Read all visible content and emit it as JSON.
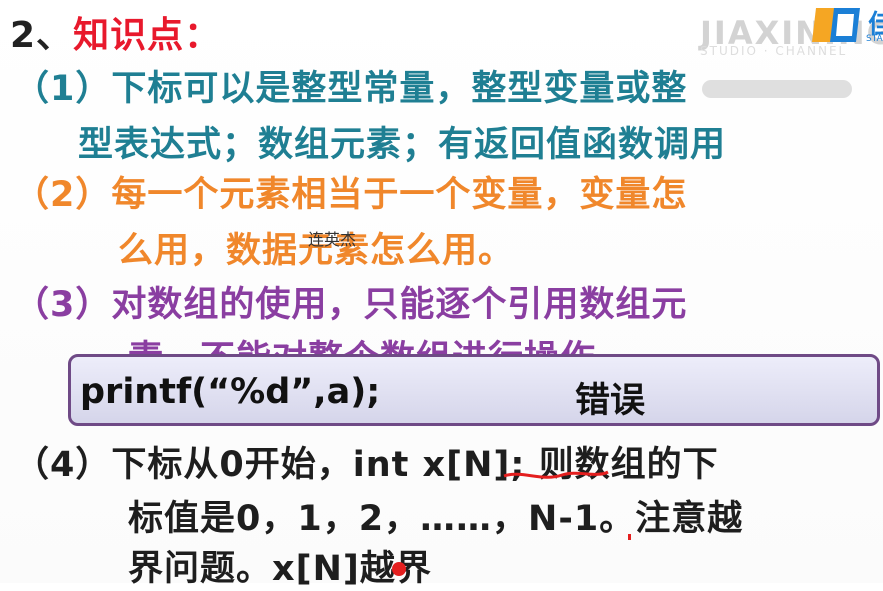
{
  "heading": {
    "number": "2、",
    "title": "知识点："
  },
  "watermark": {
    "brand_text": "JIAXINING",
    "sub_text": "STUDIO · CHANNEL"
  },
  "logo": {
    "text": "佳",
    "sub": "STA"
  },
  "overlay_name": "连英杰",
  "point1": {
    "line1": "（1）下标可以是整型常量，整型变量或整",
    "line2": "型表达式；数组元素；有返回值函数调用"
  },
  "point2": {
    "line1": "（2）每一个元素相当于一个变量，变量怎",
    "line2": "么用，数据元素怎么用。"
  },
  "point3": {
    "line1": "（3）对数组的使用，只能逐个引用数组元",
    "line2": "素，不能对整个数组进行操作。"
  },
  "code": {
    "statement": "printf(“%d”,a);",
    "verdict": "错误"
  },
  "point4": {
    "line1": "（4）下标从0开始，int  x[N]; 则数组的下",
    "line2": "标值是0，1，2，……，N-1。注意越",
    "line3": "界问题。x[N]越界"
  },
  "colors": {
    "heading_red": "#e8192c",
    "teal": "#1f7f93",
    "orange": "#f0872b",
    "purple": "#8a3ea1",
    "code_border": "#6f4a86",
    "logo_blue": "#1b7fd6"
  }
}
